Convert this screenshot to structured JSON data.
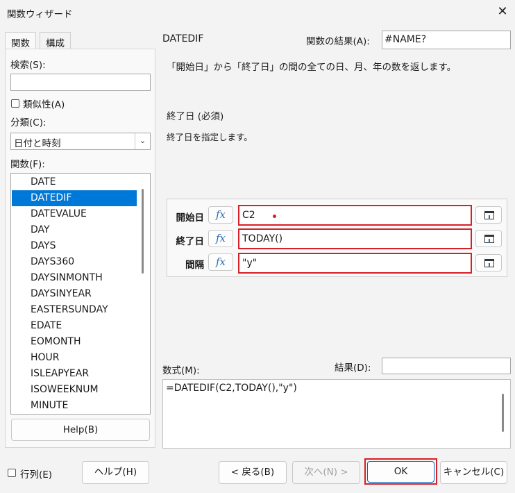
{
  "window": {
    "title": "関数ウィザード"
  },
  "tabs": [
    {
      "label": "関数"
    },
    {
      "label": "構成"
    }
  ],
  "left": {
    "search_label": "検索(S):",
    "search_value": "",
    "similarity_label": "類似性(A)",
    "category_label": "分類(C):",
    "category_value": "日付と時刻",
    "functions_label": "関数(F):",
    "functions": [
      "DATE",
      "DATEDIF",
      "DATEVALUE",
      "DAY",
      "DAYS",
      "DAYS360",
      "DAYSINMONTH",
      "DAYSINYEAR",
      "EASTERSUNDAY",
      "EDATE",
      "EOMONTH",
      "HOUR",
      "ISLEAPYEAR",
      "ISOWEEKNUM",
      "MINUTE"
    ],
    "selected_function": "DATEDIF",
    "help_button": "Help(B)"
  },
  "right": {
    "function_name": "DATEDIF",
    "result_label": "関数の結果(A):",
    "result_value": "#NAME?",
    "description": "「開始日」から「終了日」の間の全ての日、月、年の数を返します。",
    "param_title": "終了日 (必須)",
    "param_desc": "終了日を指定します。",
    "fx_symbol": "fx",
    "args": [
      {
        "label": "開始日",
        "value": "C2"
      },
      {
        "label": "終了日",
        "value": "TODAY()"
      },
      {
        "label": "間隔",
        "value": "\"y\""
      }
    ],
    "formula_label": "数式(M):",
    "formula_result_label": "結果(D):",
    "formula_result_value": "",
    "formula": "=DATEDIF(C2,TODAY(),\"y\")"
  },
  "footer": {
    "array_label": "行列(E)",
    "help_button": "ヘルプ(H)",
    "back_button": "< 戻る(B)",
    "next_button": "次へ(N) >",
    "ok_button": "OK",
    "cancel_button": "キャンセル(C)"
  },
  "colors": {
    "accent": "#0078d7",
    "highlight": "#d61f26"
  }
}
